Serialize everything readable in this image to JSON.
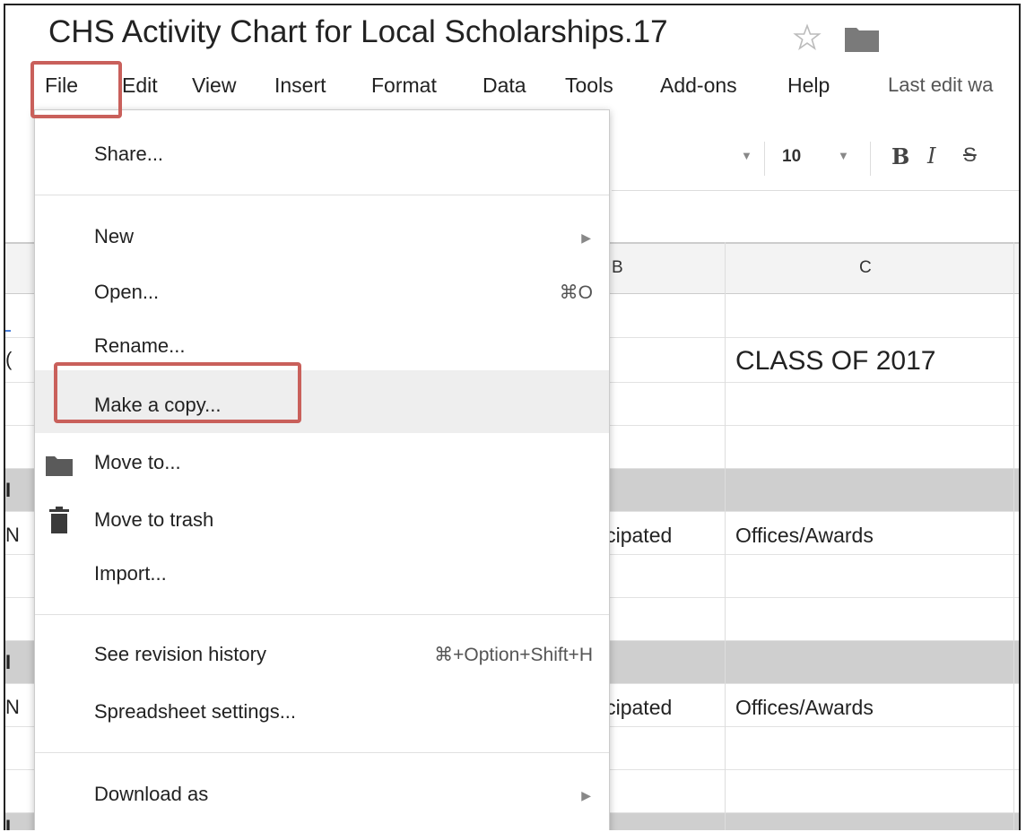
{
  "title": "CHS Activity Chart for Local Scholarships.17",
  "menubar": {
    "items": [
      "File",
      "Edit",
      "View",
      "Insert",
      "Format",
      "Data",
      "Tools",
      "Add-ons",
      "Help"
    ],
    "last_edit": "Last edit wa"
  },
  "toolbar": {
    "font_size": "10",
    "bold": "B",
    "italic": "I",
    "strike": "S"
  },
  "sheet": {
    "columns": [
      "B",
      "C"
    ],
    "class_label": "CLASS OF 2017",
    "cells": {
      "participated_1": "icipated",
      "offices_1": "Offices/Awards",
      "participated_2": "icipated",
      "offices_2": "Offices/Awards"
    },
    "left_stubs": [
      "(",
      "I",
      "N",
      "I",
      "N",
      "I"
    ]
  },
  "file_menu": {
    "share": "Share...",
    "new": "New",
    "open": "Open...",
    "open_shortcut": "⌘O",
    "rename": "Rename...",
    "make_copy": "Make a copy...",
    "move_to": "Move to...",
    "move_to_trash": "Move to trash",
    "import": "Import...",
    "revision_history": "See revision history",
    "revision_shortcut": "⌘+Option+Shift+H",
    "spreadsheet_settings": "Spreadsheet settings...",
    "download_as": "Download as"
  },
  "colors": {
    "highlight": "#c9605b",
    "band": "#cfcfcf",
    "hover": "#eeeeee"
  }
}
